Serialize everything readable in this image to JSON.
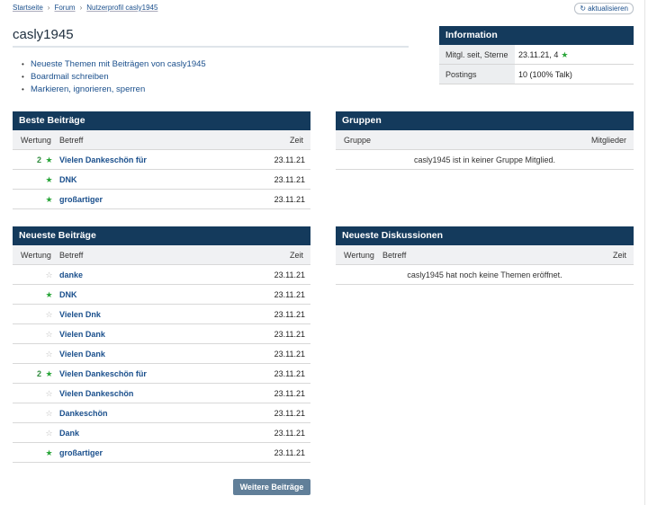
{
  "breadcrumb": {
    "items": [
      "Startseite",
      "Forum",
      "Nutzerprofil casly1945"
    ]
  },
  "refresh": {
    "icon": "refresh-icon",
    "label": "aktualisieren"
  },
  "page": {
    "title": "casly1945"
  },
  "actions": [
    "Neueste Themen mit Beiträgen von casly1945",
    "Boardmail schreiben",
    "Markieren, ignorieren, sperren"
  ],
  "info": {
    "title": "Information",
    "rows": [
      {
        "key": "Mitgl. seit, Sterne",
        "value": "23.11.21, 4",
        "star": "star-filled-icon"
      },
      {
        "key": "Postings",
        "value": "10 (100% Talk)"
      }
    ]
  },
  "best_posts": {
    "title": "Beste Beiträge",
    "columns": {
      "rating": "Wertung",
      "subject": "Betreff",
      "time": "Zeit"
    },
    "rows": [
      {
        "count": "2",
        "star": "filled",
        "subject": "Vielen Dankeschön für",
        "time": "23.11.21"
      },
      {
        "count": "",
        "star": "filled",
        "subject": "DNK",
        "time": "23.11.21"
      },
      {
        "count": "",
        "star": "filled",
        "subject": "großartiger",
        "time": "23.11.21"
      }
    ]
  },
  "groups": {
    "title": "Gruppen",
    "columns": {
      "group": "Gruppe",
      "members": "Mitglieder"
    },
    "empty": "casly1945 ist in keiner Gruppe Mitglied."
  },
  "latest_posts": {
    "title": "Neueste Beiträge",
    "columns": {
      "rating": "Wertung",
      "subject": "Betreff",
      "time": "Zeit"
    },
    "rows": [
      {
        "count": "",
        "star": "empty",
        "subject": "danke",
        "time": "23.11.21"
      },
      {
        "count": "",
        "star": "filled",
        "subject": "DNK",
        "time": "23.11.21"
      },
      {
        "count": "",
        "star": "empty",
        "subject": "Vielen Dnk",
        "time": "23.11.21"
      },
      {
        "count": "",
        "star": "empty",
        "subject": "Vielen Dank",
        "time": "23.11.21"
      },
      {
        "count": "",
        "star": "empty",
        "subject": "Vielen Dank",
        "time": "23.11.21"
      },
      {
        "count": "2",
        "star": "filled",
        "subject": "Vielen Dankeschön für",
        "time": "23.11.21"
      },
      {
        "count": "",
        "star": "empty",
        "subject": "Vielen Dankeschön",
        "time": "23.11.21"
      },
      {
        "count": "",
        "star": "empty",
        "subject": "Dankeschön",
        "time": "23.11.21"
      },
      {
        "count": "",
        "star": "empty",
        "subject": "Dank",
        "time": "23.11.21"
      },
      {
        "count": "",
        "star": "filled",
        "subject": "großartiger",
        "time": "23.11.21"
      }
    ],
    "more_label": "Weitere Beiträge"
  },
  "latest_discussions": {
    "title": "Neueste Diskussionen",
    "columns": {
      "rating": "Wertung",
      "subject": "Betreff",
      "time": "Zeit"
    },
    "empty": "casly1945 hat noch keine Themen eröffnet."
  },
  "colors": {
    "header": "#143a5c",
    "link": "#1a4f8c",
    "star": "#2aa63a",
    "button": "#617f99"
  }
}
